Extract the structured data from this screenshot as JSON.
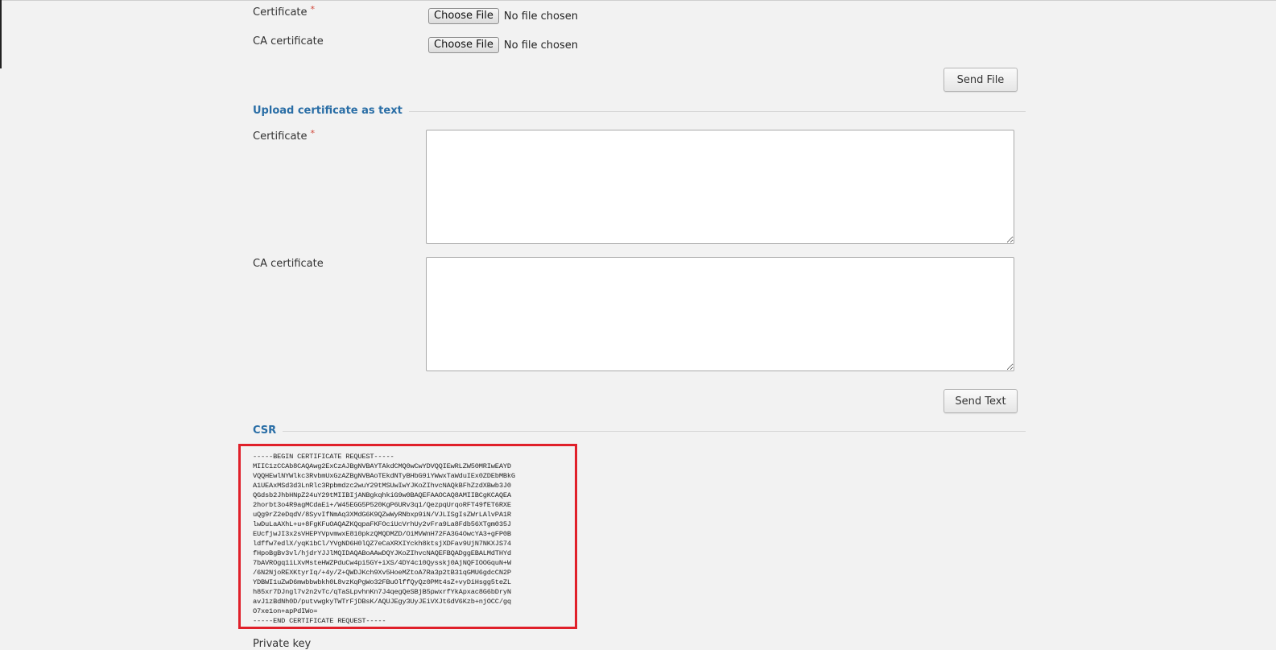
{
  "file_upload": {
    "certificate_label": "Certificate",
    "ca_certificate_label": "CA certificate",
    "required_marker": "*",
    "choose_file_label": "Choose File",
    "no_file_text": "No file chosen",
    "send_file_label": "Send File"
  },
  "text_upload": {
    "section_title": "Upload certificate as text",
    "certificate_label": "Certificate",
    "ca_certificate_label": "CA certificate",
    "certificate_value": "",
    "ca_certificate_value": "",
    "send_text_label": "Send Text"
  },
  "csr": {
    "section_title": "CSR",
    "lines": [
      "-----BEGIN CERTIFICATE REQUEST-----",
      "MIIC1zCCAb8CAQAwg2ExCzAJBgNVBAYTAkdCMQ0wCwYDVQQIEwRLZW50MRIwEAYD",
      "VQQHEwlNYWlkc3RvbmUxGzAZBgNVBAoTEkdNTyBHbG9iYWwxTaWduIEx0ZDEbMBkG",
      "A1UEAxMSd3d3LnRlc3Rpbmdzc2wuY29tMSUwIwYJKoZIhvcNAQkBFhZzdXBwb3J0",
      "QGdsb2JhbHNpZ24uY29tMIIBIjANBgkqhkiG9w0BAQEFAAOCAQ8AMIIBCgKCAQEA",
      "2horbt3o4R9agMCdaEi+/W45EGG5P520KgP6URv3q1/QezpqUrqoRFT49fET6RXE",
      "uQg9rZ2eDqdV/8SyvIfNmAq3XMdG6K9QZwWyRNbxp9iN/VJLISgIsZWrLAlvPA1R",
      "lwDuLaAXhL+u+8FgKFuOAQAZKQqpaFKFOciUcVrhUy2vFra9La8Fdb56XTgm035J",
      "EUcfjwJI3x2sVHEPYVpvmwxE810pkzQMQDMZD/OiMVWnH72FA3G4OwcYA3+gFP0B",
      "ldffw7edlX/yqK1bCl/YVgND6H0lQZ7eCaXRXIYckh8ktsjXDFav9UjN7NKXJS74",
      "fHpoBgBv3vl/hjdrYJJlMQIDAQABoAAwDQYJKoZIhvcNAQEFBQADggEBALMdTHYd",
      "7bAVROgq1iLXvMsteHWZPduCw4pi5GY+iXS/4DY4c10Qysskj0AjNQFIOOGquN+W",
      "/6N2NjoREXKtyrIq/+4y/Z+QWDJKch9Xv5HoeMZtoA7Ra3p2tB31qGMU6gdcCN2P",
      "YDBWI1uZwD6mwbbwbkh0L8vzKqPgWo32FBuOlffQyQz0PMt4sZ+vyDiHsgg5teZL",
      "h85xr7DJngl7v2n2vTc/qTaSLpvhnKn7J4qegQeSBjB5pwxrfYkApxac8G6bDryN",
      "avJ1zBdNh0D/putvwgkyTWTrFjDBsK/AQUJEgy3UyJEiVXJt6dV6Kzb+njOCC/gq",
      "O7xe1on+apPdIWo=",
      "-----END CERTIFICATE REQUEST-----"
    ]
  },
  "next_section_label": "Private key"
}
